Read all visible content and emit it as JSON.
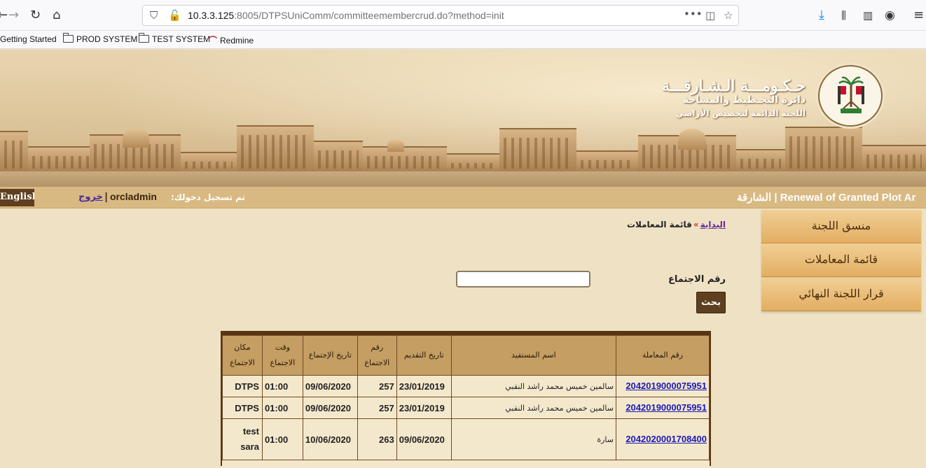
{
  "browser": {
    "url_host": "10.3.3.125",
    "url_path": ":8005/DTPSUniComm/committeemembercrud.do?method=init",
    "bookmarks": [
      "Getting Started",
      "PROD SYSTEM",
      "TEST SYSTEM",
      "Redmine"
    ]
  },
  "header": {
    "gov_title": "حـكـومـــة الـشـارقـــة",
    "gov_sub1": "دائرة التخـطيط والمساحة",
    "gov_sub2": "اللجنة الدائمة لتخصيص الأراضي"
  },
  "infobar": {
    "language_button": "English",
    "logout": "خروج",
    "separator": "|",
    "username": "orcladmin",
    "logged_in_label": "تم تسجيل دخولك:",
    "app_title": "الشارقة | Renewal of Granted Plot Ar"
  },
  "menu": {
    "items": [
      "منسق اللجنة",
      "قائمة المعاملات",
      "قرار اللجنة النهائي"
    ]
  },
  "breadcrumb": {
    "home": "البداية",
    "arrow": "»",
    "current": "قائمة المعاملات"
  },
  "search": {
    "label": "رقم الاجتماع",
    "value": "",
    "button": "بحث"
  },
  "table": {
    "headers": [
      "مكان الاجتماع",
      "وقت الاجتماع",
      "تاريخ الإجتماع",
      "رقم الاجتماع",
      "تاريخ التقديم",
      "اسم المستفيد",
      "رقم المعاملة"
    ],
    "rows": [
      {
        "place": "DTPS",
        "time": "01:00",
        "meeting_date": "09/06/2020",
        "meeting_no": "257",
        "submit_date": "23/01/2019",
        "beneficiary": "سالمين خميس محمد راشد النقبي",
        "transaction_no": "2042019000075951"
      },
      {
        "place": "DTPS",
        "time": "01:00",
        "meeting_date": "09/06/2020",
        "meeting_no": "257",
        "submit_date": "23/01/2019",
        "beneficiary": "سالمين خميس محمد راشد النقبي",
        "transaction_no": "2042019000075951"
      },
      {
        "place": "test sara",
        "time": "01:00",
        "meeting_date": "10/06/2020",
        "meeting_no": "263",
        "submit_date": "09/06/2020",
        "beneficiary": "سارة",
        "transaction_no": "2042020001708400"
      }
    ]
  }
}
